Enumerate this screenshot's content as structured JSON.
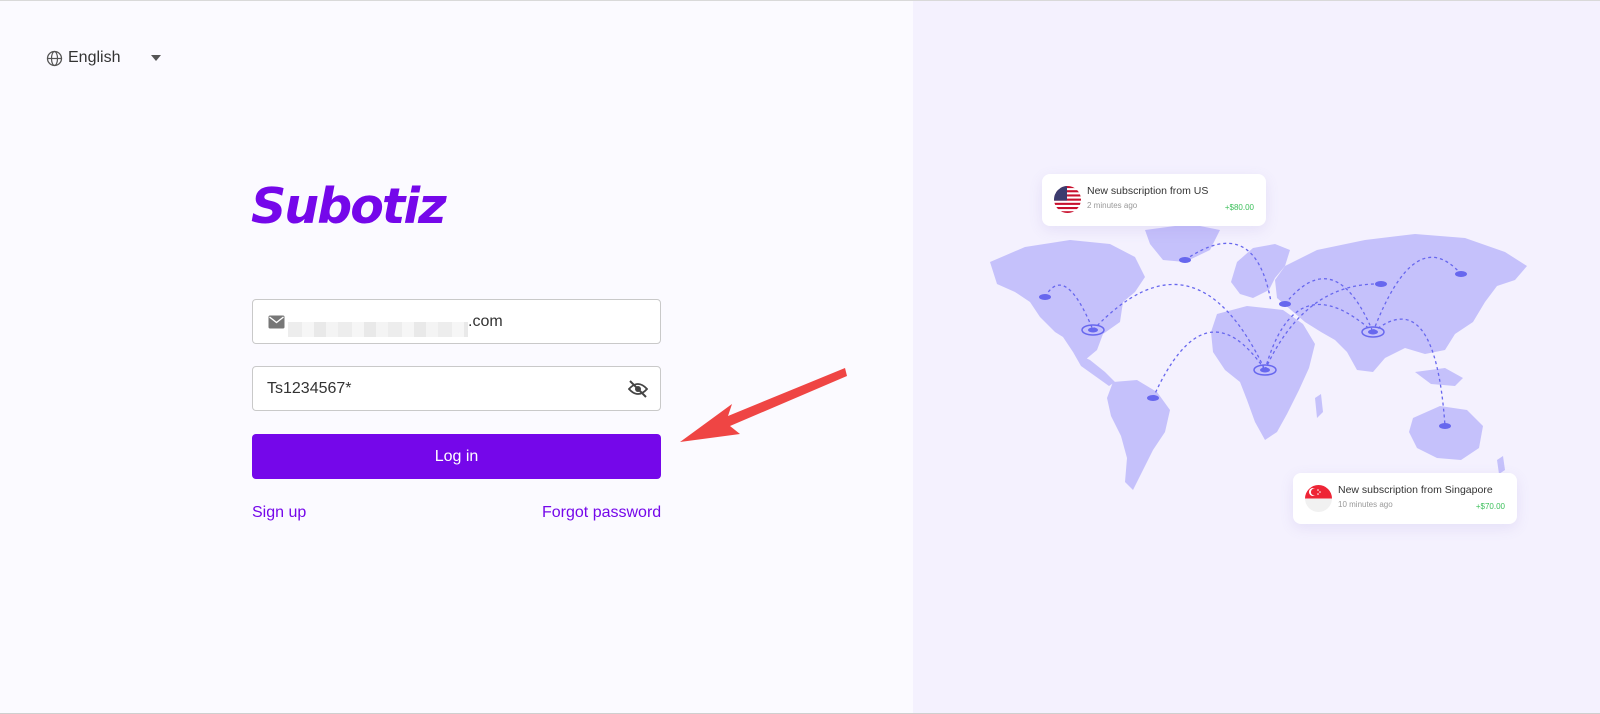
{
  "language": {
    "label": "English"
  },
  "brand": {
    "name": "Subotiz",
    "color": "#7507ea"
  },
  "login_form": {
    "email_suffix": ".com",
    "password_value": "Ts1234567*",
    "login_label": "Log in",
    "signup_label": "Sign up",
    "forgot_label": "Forgot password"
  },
  "notifications": [
    {
      "title": "New subscription from US",
      "time": "2 minutes ago",
      "amount": "+$80.00"
    },
    {
      "title": "New subscription from Singapore",
      "time": "10 minutes ago",
      "amount": "+$70.00"
    }
  ],
  "colors": {
    "accent": "#7507ea",
    "success": "#3bbf5a",
    "map": "#c5c1fb",
    "annotation": "#ef4544"
  },
  "icons": [
    "globe-icon",
    "chevron-down-icon",
    "mail-icon",
    "eye-off-icon",
    "us-flag-icon",
    "singapore-flag-icon",
    "world-map"
  ]
}
